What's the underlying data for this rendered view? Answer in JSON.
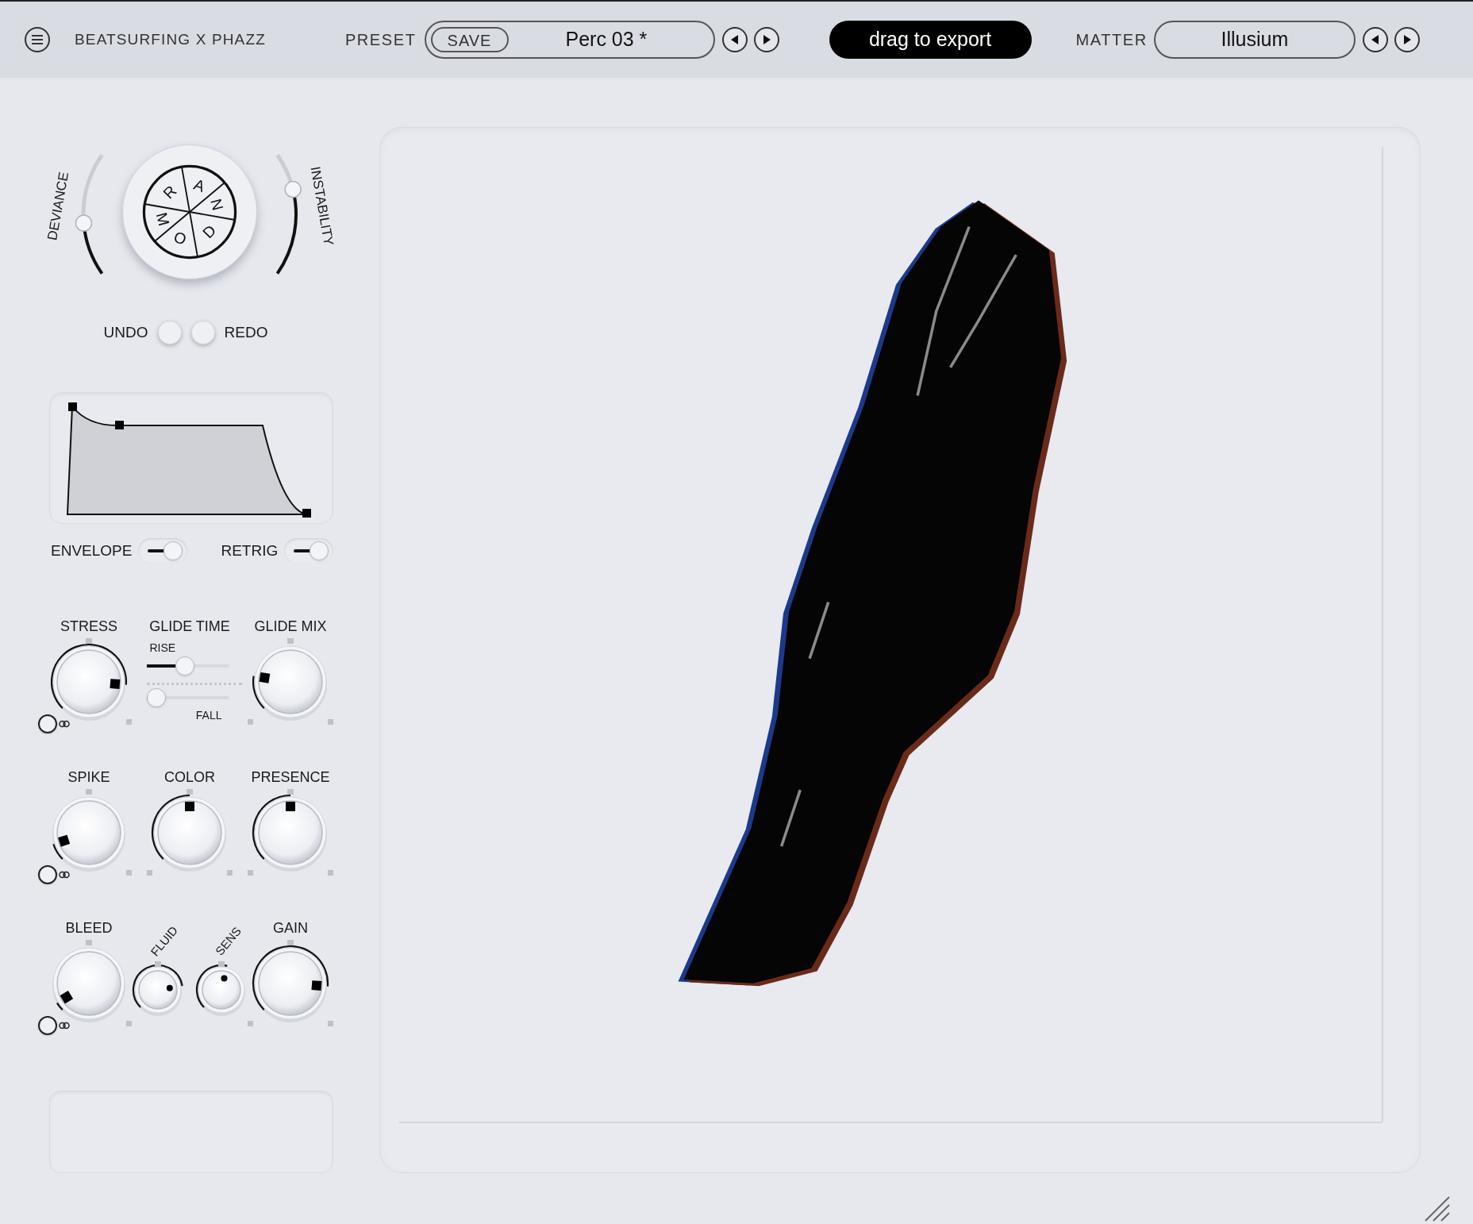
{
  "header": {
    "brand": "BEATSURFING X PHAZZ",
    "preset_label": "PRESET",
    "save_button": "SAVE",
    "preset_name": "Perc 03 *",
    "export_button": "drag to export",
    "matter_label": "MATTER",
    "matter_name": "Illusium"
  },
  "random": {
    "letters": [
      "R",
      "A",
      "N",
      "D",
      "O",
      "M"
    ],
    "sliders": [
      {
        "label": "DEVIANCE",
        "level": 0.43
      },
      {
        "label": "INSTABILITY",
        "level": 0.7
      }
    ],
    "undo": "UNDO",
    "redo": "REDO"
  },
  "toggles": [
    {
      "label": "ENVELOPE",
      "on": true
    },
    {
      "label": "RETRIG",
      "on": true
    }
  ],
  "knob_rows": [
    [
      {
        "kind": "knob",
        "label": "STRESS",
        "level": 0.85,
        "link": true
      },
      {
        "kind": "glide",
        "label": "GLIDE TIME",
        "sliders": [
          {
            "label": "RISE",
            "level": 0.45
          },
          {
            "label": "FALL",
            "level": 0
          }
        ]
      },
      {
        "kind": "knob",
        "label": "GLIDE MIX",
        "level": 0.2,
        "link": false
      }
    ],
    [
      {
        "kind": "knob",
        "label": "SPIKE",
        "level": 0.1,
        "link": true
      },
      {
        "kind": "knob",
        "label": "COLOR",
        "level": 0.5,
        "link": false
      },
      {
        "kind": "knob",
        "label": "PRESENCE",
        "level": 0.5,
        "link": false
      }
    ],
    [
      {
        "kind": "knob",
        "label": "BLEED",
        "level": 0.05,
        "link": true
      },
      {
        "kind": "minis",
        "items": [
          {
            "label": "FLUID",
            "level": 0.8
          },
          {
            "label": "SENS",
            "level": 0.55
          }
        ]
      },
      {
        "kind": "knob",
        "label": "GAIN",
        "level": 0.85,
        "link": false
      }
    ]
  ]
}
